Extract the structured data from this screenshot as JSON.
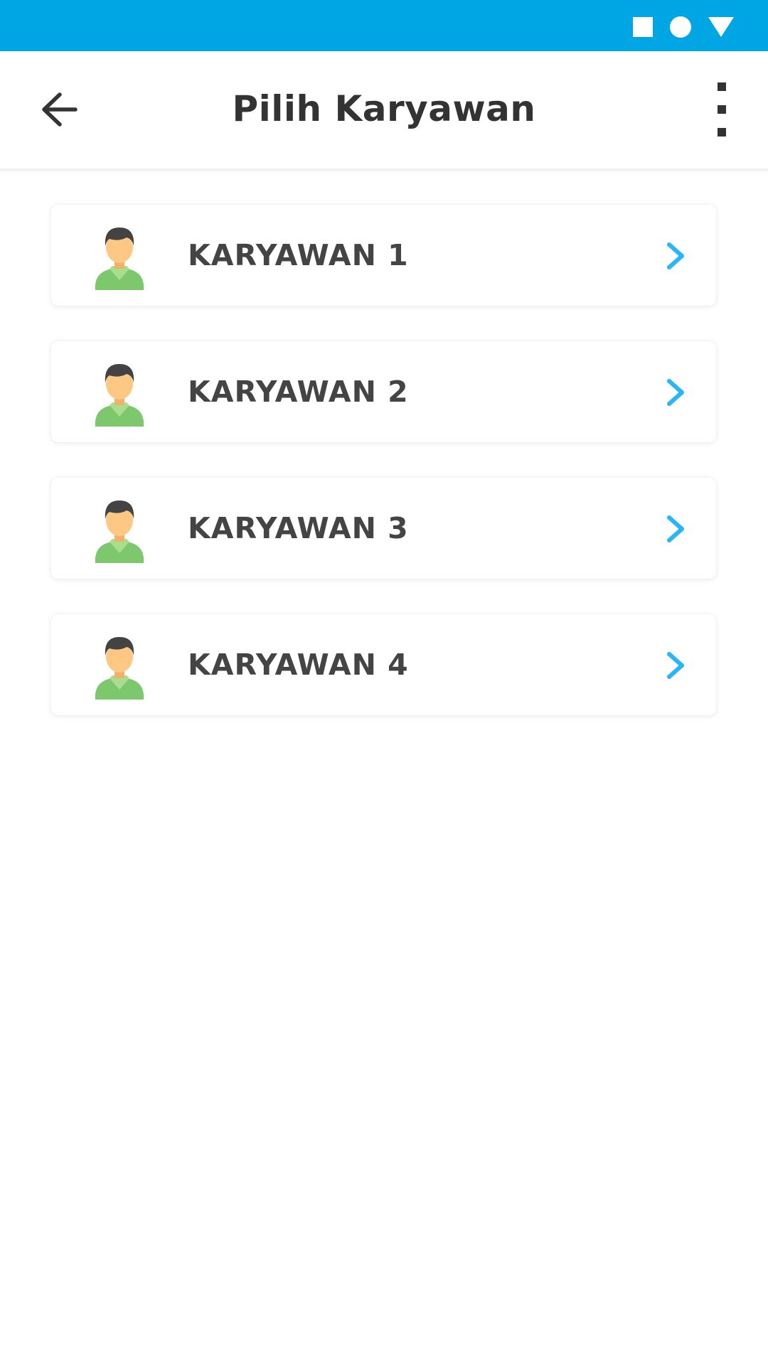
{
  "status_bar": {
    "icons": [
      "square-icon",
      "circle-icon",
      "triangle-icon"
    ],
    "color": "#00a5e3"
  },
  "app_bar": {
    "title": "Pilih Karyawan",
    "back_icon": "arrow-left-icon",
    "menu_icon": "more-vertical-icon"
  },
  "employees": [
    {
      "label": "KARYAWAN 1"
    },
    {
      "label": "KARYAWAN 2"
    },
    {
      "label": "KARYAWAN 3"
    },
    {
      "label": "KARYAWAN 4"
    }
  ],
  "colors": {
    "accent": "#29b6f6",
    "title_text": "#333333",
    "item_text": "#444444",
    "avatar_shirt": "#7dc86d",
    "avatar_skin": "#fdc784",
    "avatar_hair": "#434343"
  }
}
